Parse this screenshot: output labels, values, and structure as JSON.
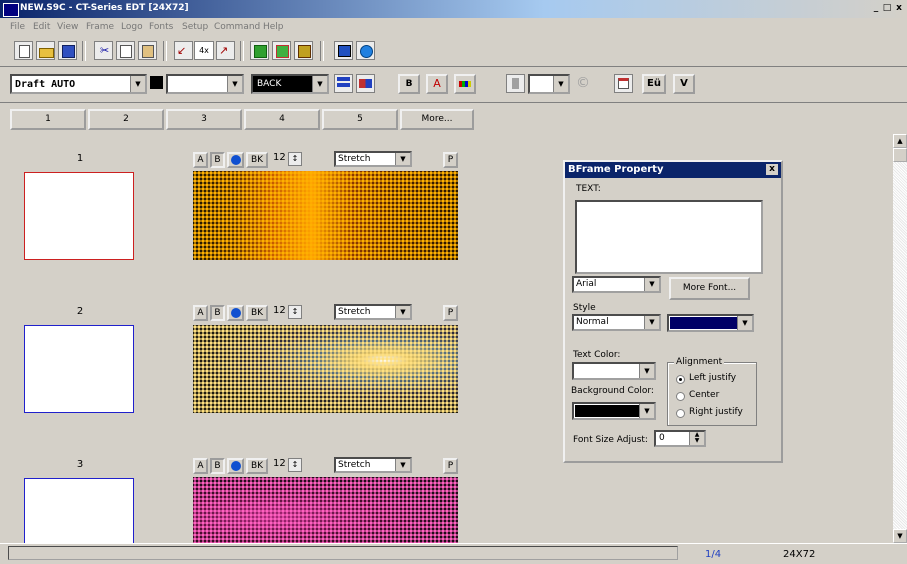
{
  "window": {
    "title": "NEW.S9C - CT-Series EDT  [24X72]",
    "controls": [
      "_",
      "□",
      "x"
    ]
  },
  "menu": {
    "items": [
      "File",
      "Edit",
      "View",
      "Frame",
      "Logo",
      "Fonts",
      "Setup",
      "Command",
      "Help"
    ]
  },
  "toolbar1": {
    "zoom_label": "4x"
  },
  "toolbar2": {
    "mode_value": "Draft AUTO",
    "style_value": "",
    "back_value": "BACK",
    "bold_label": "B",
    "font_color_label": "A",
    "color_bars_label": "",
    "small_combo_value": "",
    "copyright_label": "©",
    "eu_label": "Eü",
    "v_label": "V"
  },
  "tabs": [
    "1",
    "2",
    "3",
    "4",
    "5",
    "More..."
  ],
  "frames": [
    {
      "number": "1",
      "btn_a": "A",
      "btn_b": "B",
      "btn_bk": "BK",
      "size": "12",
      "mode": "Stretch",
      "btn_p": "P",
      "border": "#cc2020"
    },
    {
      "number": "2",
      "btn_a": "A",
      "btn_b": "B",
      "btn_bk": "BK",
      "size": "12",
      "mode": "Stretch",
      "btn_p": "P",
      "border": "#2020cc"
    },
    {
      "number": "3",
      "btn_a": "A",
      "btn_b": "B",
      "btn_bk": "BK",
      "size": "12",
      "mode": "Stretch",
      "btn_p": "P",
      "border": "#2020cc"
    }
  ],
  "dialog": {
    "title": "BFrame Property",
    "close": "x",
    "text_label": "TEXT:",
    "text_value": "",
    "font_value": "Arial",
    "more_font_label": "More Font...",
    "style_label": "Style",
    "style_value": "Normal",
    "style_color": "#000066",
    "text_color_label": "Text Color:",
    "text_color_value": "#ffffff",
    "bg_color_label": "Background Color:",
    "bg_color_value": "#000000",
    "alignment_label": "Alignment",
    "align_left": "Left justify",
    "align_center": "Center",
    "align_right": "Right justify",
    "align_selected": "left",
    "font_size_label": "Font Size Adjust:",
    "font_size_value": "0"
  },
  "status": {
    "page": "1/4",
    "size": "24X72"
  }
}
